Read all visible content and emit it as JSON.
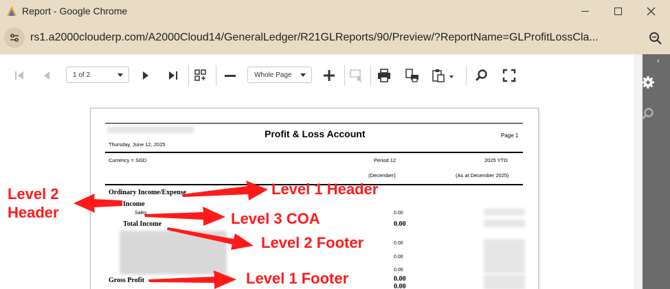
{
  "window": {
    "title": "Report - Google Chrome",
    "url": "rs1.a2000clouderp.com/A2000Cloud14/GeneralLedger/R21GLReports/90/Preview/?ReportName=GLProfitLossCla..."
  },
  "toolbar": {
    "page_selector_value": "1 of 2",
    "zoom_selector_value": "Whole Page",
    "icons": [
      "first-page-icon",
      "previous-page-icon",
      "next-page-icon",
      "last-page-icon",
      "multi-page-icon",
      "zoom-out-icon",
      "zoom-in-icon",
      "editing-fields-icon",
      "print-icon",
      "print-page-icon",
      "export-icon",
      "search-icon",
      "fullscreen-icon"
    ]
  },
  "side_panel": {
    "icons": [
      "gear-icon",
      "search-icon"
    ],
    "collapse_glyph": "‹"
  },
  "report": {
    "title": "Profit & Loss Account",
    "page_label": "Page 1",
    "date": "Thursday, June 12, 2025",
    "currency": "Currency = SGD",
    "col1_header": "Period 12",
    "col1_sub": "(December)",
    "col2_header": "2025 YTD",
    "col2_sub": "(As at December 2025)",
    "rows": [
      {
        "label": "Ordinary Income/Expense",
        "value": ""
      },
      {
        "label": "Income",
        "value": ""
      },
      {
        "label": "Sales",
        "value": "0.00"
      },
      {
        "label": "Total Income",
        "value": "0.00"
      },
      {
        "label": "",
        "value": "0.00"
      },
      {
        "label": "",
        "value": "0.00"
      },
      {
        "label": "",
        "value": "0.00"
      },
      {
        "label": "Gross Profit",
        "value": "0.00"
      },
      {
        "label": "",
        "value": "0.00"
      }
    ]
  },
  "annotations": {
    "level1_header": "Level 1 Header",
    "level2_header_line1": "Level 2",
    "level2_header_line2": "Header",
    "level3_coa": "Level 3 COA",
    "level2_footer": "Level 2 Footer",
    "level1_footer": "Level 1 Footer"
  },
  "colors": {
    "titlebar_bg": "#e8dcc4",
    "annotation_red": "#ff1a1a",
    "side_panel_bg": "#6b6b6b"
  }
}
